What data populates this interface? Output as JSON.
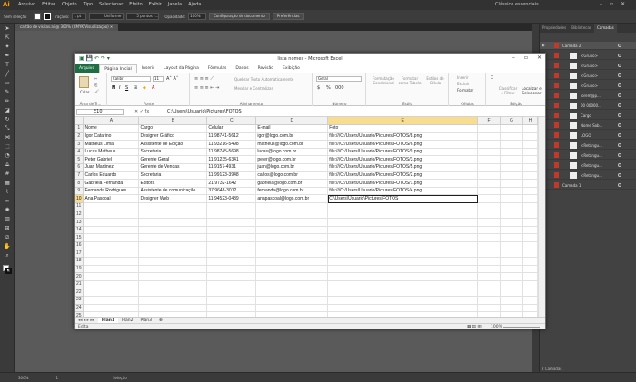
{
  "illustrator": {
    "menu": [
      "Arquivo",
      "Editar",
      "Objeto",
      "Tipo",
      "Selecionar",
      "Efeito",
      "Exibir",
      "Janela",
      "Ajuda"
    ],
    "workspace": "Clássico essenciais",
    "options_bar": {
      "selection": "Sem seleção",
      "stroke_label": "Traçado:",
      "stroke_weight": "1 pt",
      "stroke_style": "Uniforme",
      "brush": "5 pontos -...",
      "opacity_label": "Opacidade:",
      "opacity": "100%",
      "doc_setup": "Configuração de documento",
      "preferences": "Preferências"
    },
    "doc_tab": "cartão de visitas.ai @ 300% (CMYK/Visualização)",
    "status": {
      "zoom": "300%",
      "page": "1",
      "tool": "Seleção"
    },
    "layers_panel": {
      "tabs": [
        "Propriedades",
        "Bibliotecas",
        "Camadas"
      ],
      "active_tab": "Camadas",
      "rows": [
        "Camada 2",
        "<Grupo>",
        "<Grupo>",
        "<Grupo>",
        "<Grupo>",
        "lorem@p...",
        "00 00000...",
        "Cargo",
        "Nome Sob...",
        "LOGO",
        "<Retângu...",
        "<Retângu...",
        "<Retângu...",
        "<Retângu...",
        "Camada 1"
      ],
      "footer": "2 Camadas"
    }
  },
  "excel": {
    "title": "lista nomes  -  Microsoft Excel",
    "tabs": [
      "Arquivo",
      "Página Inicial",
      "Inserir",
      "Layout da Página",
      "Fórmulas",
      "Dados",
      "Revisão",
      "Exibição"
    ],
    "active_tab": "Página Inicial",
    "ribbon": {
      "clipboard": {
        "paste": "Colar",
        "label": "Área de Tr..."
      },
      "font": {
        "name": "Calibri",
        "size": "11",
        "label": "Fonte",
        "bold": "N",
        "italic": "I",
        "underline": "S"
      },
      "alignment": {
        "wrap": "Quebrar Texto Automaticamente",
        "merge": "Mesclar e Centralizar",
        "label": "Alinhamento"
      },
      "number": {
        "format": "Geral",
        "label": "Número",
        "currency": "$",
        "percent": "%",
        "thousands": "000"
      },
      "styles": {
        "conditional": "Formatação Condicional",
        "as_table": "Formatar como Tabela",
        "cell_styles": "Estilos de Célula",
        "label": "Estilo"
      },
      "cells": {
        "insert": "Inserir",
        "delete": "Excluir",
        "format": "Formatar",
        "label": "Células"
      },
      "editing": {
        "sort": "Classificar e Filtrar",
        "find": "Localizar e Selecionar",
        "label": "Edição"
      }
    },
    "name_box": "E10",
    "formula": "C:\\Users\\Usuario\\Pictures\\FOTOS",
    "columns": [
      "A",
      "B",
      "C",
      "D",
      "E",
      "F",
      "G",
      "H"
    ],
    "selected_column": "E",
    "selected_row": 10,
    "rows": [
      [
        "Nome",
        "Cargo",
        "Celular",
        "E-mail",
        "Foto"
      ],
      [
        "Igor Catarino",
        "Designer Gráfico",
        "11 98741-5612",
        "igor@logo.com.br",
        "file:///C:/Users/Usuario/Pictures/FOTOS/8.png"
      ],
      [
        "Matheus Lima",
        "Assistente de Edição",
        "11 93216-5498",
        "matheus@logo.com.br",
        "file:///C:/Users/Usuario/Pictures/FOTOS/6.png"
      ],
      [
        "Lucas Matheus",
        "Secretaria",
        "11 98745-5698",
        "lucas@logo.com.br",
        "file:///C:/Users/Usuario/Pictures/FOTOS/9.png"
      ],
      [
        "Peter Gabriel",
        "Gerente Geral",
        "11 91235-6341",
        "peter@logo.com.br",
        "file:///C:/Users/Usuario/Pictures/FOTOS/3.png"
      ],
      [
        "Juan Martinez",
        "Gerente de Vendas",
        "11 9157-4931",
        "juan@logo.com.br",
        "file:///C:/Users/Usuario/Pictures/FOTOS/5.png"
      ],
      [
        "Carlos Eduardo",
        "Secretaria",
        "11 99123-3948",
        "carlos@logo.com.br",
        "file:///C:/Users/Usuario/Pictures/FOTOS/2.png"
      ],
      [
        "Gabriela Fernanda",
        "Editora",
        "21 9732-1642",
        "gabriela@logo.com.br",
        "file:///C:/Users/Usuario/Pictures/FOTOS/1.png"
      ],
      [
        "Fernanda Rodrigues",
        "Assistente de comunicação",
        "37 9648-3012",
        "fernanda@logo.com.br",
        "file:///C:/Users/Usuario/Pictures/FOTOS/4.png"
      ],
      [
        "Ana Pascoal",
        "Designer Web",
        "11 94523-0489",
        "anapascoal@logo.com.br",
        "C:\\Users\\Usuario\\Pictures\\FOTOS"
      ]
    ],
    "sheet_tabs": [
      "Plan1",
      "Plan2",
      "Plan3"
    ],
    "active_sheet": "Plan1",
    "status": "Edita",
    "zoom": "100%"
  }
}
